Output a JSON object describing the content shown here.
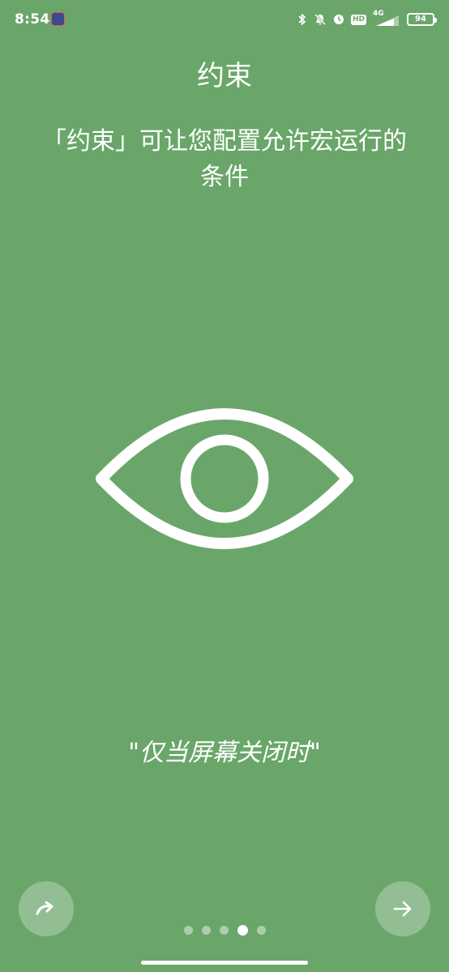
{
  "status_bar": {
    "time": "8:54",
    "network": "4G",
    "hd": "HD",
    "battery": "94"
  },
  "intro": {
    "title": "约束",
    "description": "「约束」可让您配置允许宏运行的条件",
    "example": "\"仅当屏幕关闭时\""
  },
  "pager": {
    "total": 5,
    "current": 4
  },
  "icons": {
    "hero": "eye-icon",
    "skip": "redo-arrow-icon",
    "next": "arrow-right-icon"
  },
  "colors": {
    "background": "#6aa66a",
    "foreground": "#ffffff"
  }
}
